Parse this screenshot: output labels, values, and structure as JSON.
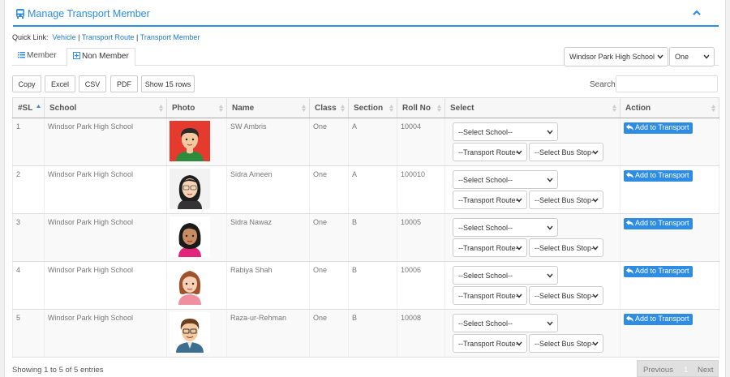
{
  "header": {
    "title": "Manage Transport Member"
  },
  "quick_links": {
    "label": "Quick Link:",
    "items": [
      "Vehicle",
      "Transport Route",
      "Transport Member"
    ],
    "separator": " | "
  },
  "tabs": [
    {
      "label": "Member",
      "icon": "list-icon"
    },
    {
      "label": "Non Member",
      "icon": "plus-square-icon"
    }
  ],
  "filters": {
    "school": "Windsor Park High School",
    "class": "One"
  },
  "buttons": [
    "Copy",
    "Excel",
    "CSV",
    "PDF",
    "Show 15 rows"
  ],
  "search": {
    "label": "Search",
    "value": ""
  },
  "table": {
    "columns": [
      "#SL",
      "School",
      "Photo",
      "Name",
      "Class",
      "Section",
      "Roll No",
      "Select",
      "Action"
    ],
    "rows": [
      {
        "sl": "1",
        "school": "Windsor Park High School",
        "name": "SW Ambris",
        "class": "One",
        "section": "A",
        "roll": "10004"
      },
      {
        "sl": "2",
        "school": "Windsor Park High School",
        "name": "Sidra Ameen",
        "class": "One",
        "section": "A",
        "roll": "100010"
      },
      {
        "sl": "3",
        "school": "Windsor Park High School",
        "name": "Sidra Nawaz",
        "class": "One",
        "section": "B",
        "roll": "10005"
      },
      {
        "sl": "4",
        "school": "Windsor Park High School",
        "name": "Rabiya Shah",
        "class": "One",
        "section": "B",
        "roll": "10006"
      },
      {
        "sl": "5",
        "school": "Windsor Park High School",
        "name": "Raza-ur-Rehman",
        "class": "One",
        "section": "B",
        "roll": "10008"
      }
    ],
    "select_school": "--Select School--",
    "select_route": "--Transport Route--",
    "select_stop": "--Select Bus Stop--",
    "action_label": "Add to Transport"
  },
  "footer": {
    "info": "Showing 1 to 5 of 5 entries",
    "previous": "Previous",
    "page": "1",
    "next": "Next"
  },
  "colors": {
    "accent": "#2e8ce3"
  }
}
